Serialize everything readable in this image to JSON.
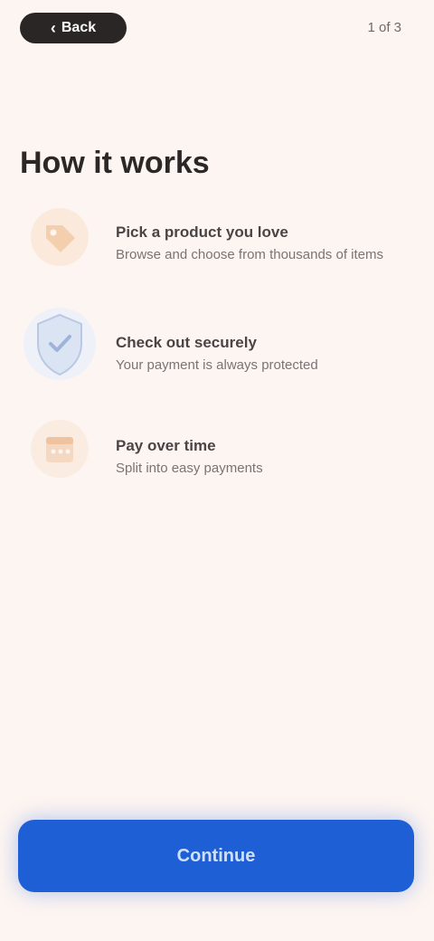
{
  "topbar": {
    "back_label": "Back",
    "step_indicator": "1 of 3"
  },
  "title": "How it works",
  "steps": [
    {
      "icon": "tag-icon",
      "title": "Pick a product you love",
      "description": "Browse and choose from thousands of items"
    },
    {
      "icon": "shield-icon",
      "title": "Check out securely",
      "description": "Your payment is always protected"
    },
    {
      "icon": "calendar-icon",
      "title": "Pay over time",
      "description": "Split into easy payments"
    }
  ],
  "continue_label": "Continue",
  "colors": {
    "background": "#fdf5f1",
    "accent": "#1f5fd6",
    "dark": "#2a2626"
  }
}
